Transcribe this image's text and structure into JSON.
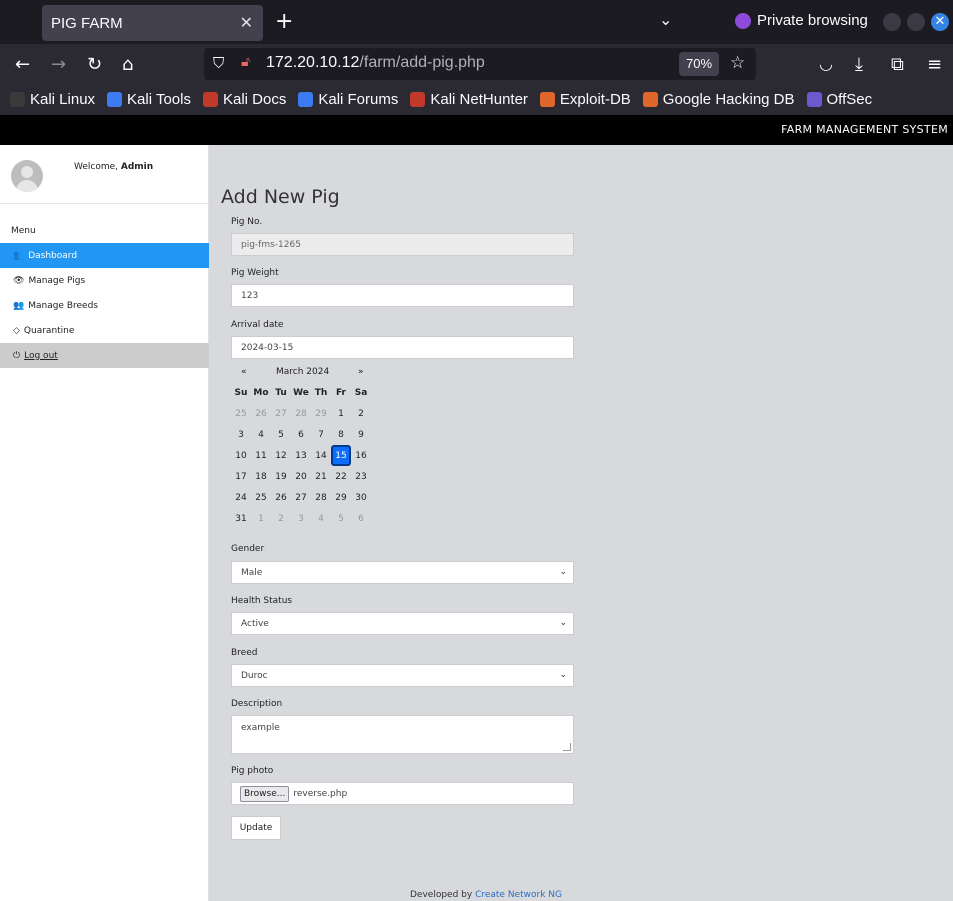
{
  "browser": {
    "tab_title": "PIG FARM",
    "tab_close": "✕",
    "new_tab": "+",
    "private_label": "Private browsing",
    "url_host": "172.20.10.12",
    "url_path": "/farm/add-pig.php",
    "zoom": "70%",
    "bookmarks": [
      {
        "label": "Kali Linux",
        "color": "#3a3a3a"
      },
      {
        "label": "Kali Tools",
        "color": "#3d7cf0"
      },
      {
        "label": "Kali Docs",
        "color": "#c0392b"
      },
      {
        "label": "Kali Forums",
        "color": "#3d7cf0"
      },
      {
        "label": "Kali NetHunter",
        "color": "#c0392b"
      },
      {
        "label": "Exploit-DB",
        "color": "#e0662b"
      },
      {
        "label": "Google Hacking DB",
        "color": "#e0662b"
      },
      {
        "label": "OffSec",
        "color": "#6a5acd"
      }
    ]
  },
  "header": {
    "system_name": "FARM MANAGEMENT SYSTEM"
  },
  "sidebar": {
    "welcome_prefix": "Welcome, ",
    "welcome_user": "Admin",
    "menu_title": "Menu",
    "items": [
      {
        "label": "Dashboard",
        "icon": "users-icon",
        "glyph": "👥"
      },
      {
        "label": "Manage Pigs",
        "icon": "eye-icon",
        "glyph": "👁"
      },
      {
        "label": "Manage Breeds",
        "icon": "users-icon",
        "glyph": "👥"
      },
      {
        "label": "Quarantine",
        "icon": "diamond-icon",
        "glyph": "◇"
      },
      {
        "label": "Log out",
        "icon": "power-icon",
        "glyph": "⏻"
      }
    ]
  },
  "form": {
    "title": "Add New Pig",
    "pig_no_label": "Pig No.",
    "pig_no_value": "pig-fms-1265",
    "weight_label": "Pig Weight",
    "weight_value": "123",
    "arrival_label": "Arrival date",
    "arrival_value": "2024-03-15",
    "gender_label": "Gender",
    "gender_value": "Male",
    "health_label": "Health Status",
    "health_value": "Active",
    "breed_label": "Breed",
    "breed_value": "Duroc",
    "description_label": "Description",
    "description_value": "example",
    "photo_label": "Pig photo",
    "browse_label": "Browse...",
    "photo_file": "reverse.php",
    "update_label": "Update"
  },
  "calendar": {
    "prev": "«",
    "next": "»",
    "month": "March 2024",
    "dow": [
      "Su",
      "Mo",
      "Tu",
      "We",
      "Th",
      "Fr",
      "Sa"
    ],
    "days": [
      [
        "25",
        "26",
        "27",
        "28",
        "29",
        "1",
        "2"
      ],
      [
        "3",
        "4",
        "5",
        "6",
        "7",
        "8",
        "9"
      ],
      [
        "10",
        "11",
        "12",
        "13",
        "14",
        "15",
        "16"
      ],
      [
        "17",
        "18",
        "19",
        "20",
        "21",
        "22",
        "23"
      ],
      [
        "24",
        "25",
        "26",
        "27",
        "28",
        "29",
        "30"
      ],
      [
        "31",
        "1",
        "2",
        "3",
        "4",
        "5",
        "6"
      ]
    ],
    "selected_day": "15"
  },
  "footer": {
    "prefix": "Developed by ",
    "link": "Create Network NG"
  }
}
